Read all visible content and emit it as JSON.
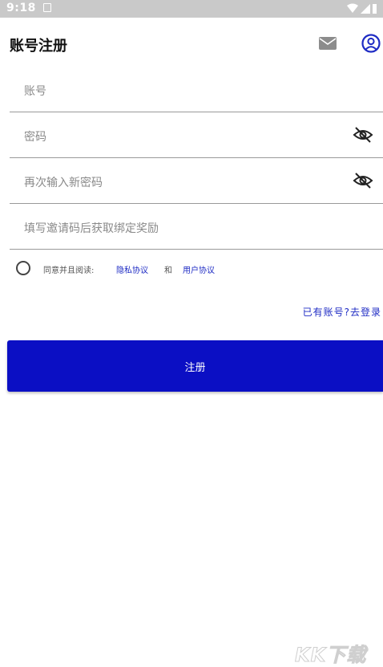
{
  "status_bar": {
    "time": "9:18"
  },
  "header": {
    "title": "账号注册"
  },
  "form": {
    "account_placeholder": "账号",
    "password_placeholder": "密码",
    "confirm_password_placeholder": "再次输入新密码",
    "invite_code_placeholder": "填写邀请码后获取绑定奖励"
  },
  "agreement": {
    "prefix": "同意并且阅读:",
    "privacy_link": "隐私协议",
    "conjunction": "和",
    "user_link": "用户协议"
  },
  "login_link": "已有账号?去登录",
  "register_button": "注册",
  "watermark": "KK下载",
  "colors": {
    "primary": "#0b0fc4",
    "link": "#1e2bc4",
    "status_bar": "#c9c9c9"
  }
}
